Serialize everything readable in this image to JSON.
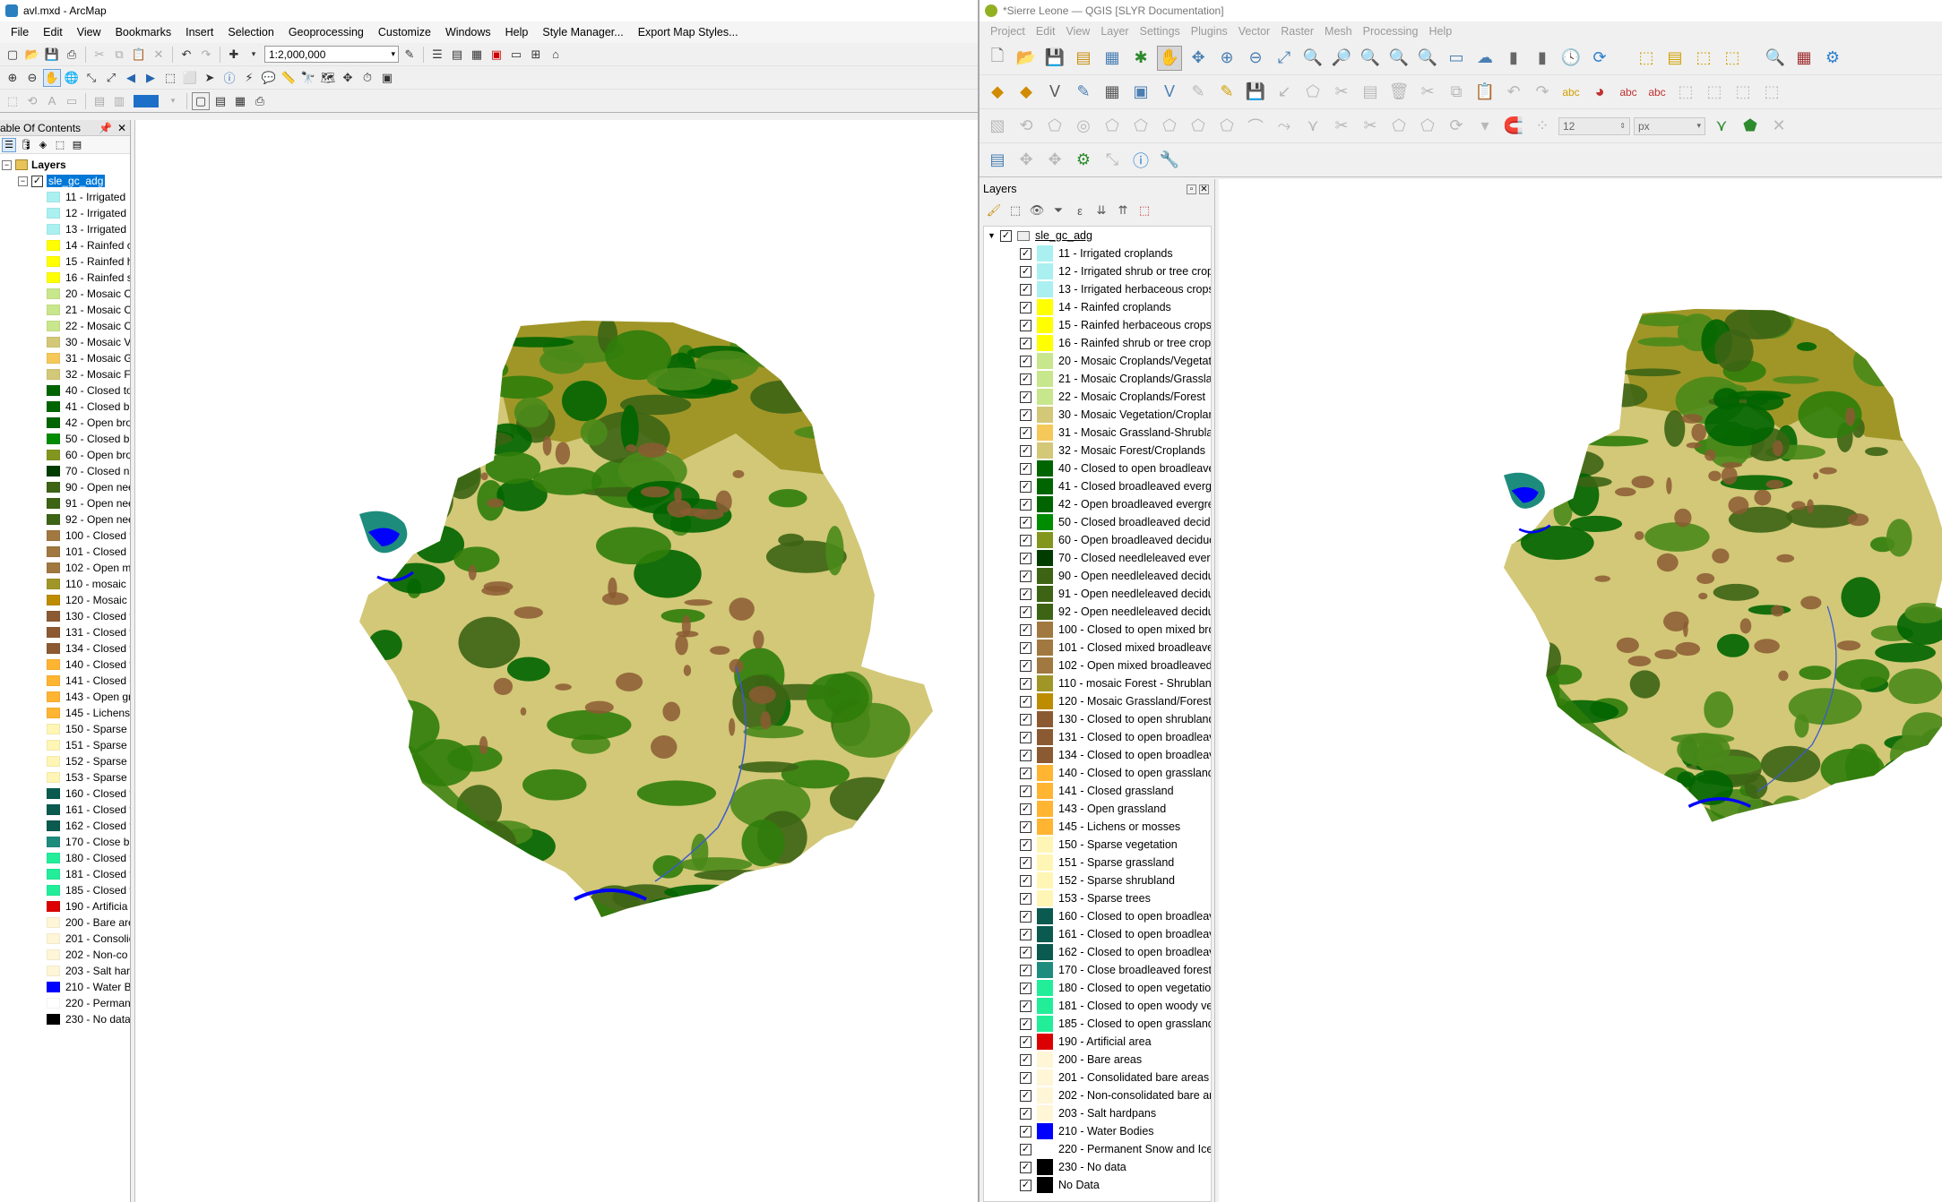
{
  "arcmap": {
    "title": "avl.mxd - ArcMap",
    "menus": [
      "File",
      "Edit",
      "View",
      "Bookmarks",
      "Insert",
      "Selection",
      "Geoprocessing",
      "Customize",
      "Windows",
      "Help",
      "Style Manager...",
      "Export Map Styles..."
    ],
    "scale": "1:2,000,000",
    "toc_title": "able Of Contents",
    "group_label": "Layers",
    "layer_name": "sle_gc_adg",
    "legend": [
      {
        "label": "11 - Irrigated",
        "color": "#aaf0f0"
      },
      {
        "label": "12 - Irrigated",
        "color": "#aaf0f0"
      },
      {
        "label": "13 - Irrigated",
        "color": "#aaf0f0"
      },
      {
        "label": "14 - Rainfed c",
        "color": "#ffff00"
      },
      {
        "label": "15 - Rainfed h",
        "color": "#ffff00"
      },
      {
        "label": "16 - Rainfed s",
        "color": "#ffff00"
      },
      {
        "label": "20 - Mosaic C",
        "color": "#c8e68c"
      },
      {
        "label": "21 - Mosaic C",
        "color": "#c8e68c"
      },
      {
        "label": "22 - Mosaic C",
        "color": "#c8e68c"
      },
      {
        "label": "30 - Mosaic V",
        "color": "#d2c878"
      },
      {
        "label": "31 - Mosaic G",
        "color": "#f5c85a"
      },
      {
        "label": "32 - Mosaic F",
        "color": "#d2c878"
      },
      {
        "label": "40 - Closed to",
        "color": "#006400"
      },
      {
        "label": "41 - Closed b",
        "color": "#006400"
      },
      {
        "label": "42 - Open bro",
        "color": "#006400"
      },
      {
        "label": "50 - Closed b",
        "color": "#008c00"
      },
      {
        "label": "60 - Open bro",
        "color": "#82961e"
      },
      {
        "label": "70 - Closed n",
        "color": "#003c00"
      },
      {
        "label": "90 - Open nee",
        "color": "#3c6414"
      },
      {
        "label": "91 - Open nee",
        "color": "#3c6414"
      },
      {
        "label": "92 - Open nee",
        "color": "#3c6414"
      },
      {
        "label": "100 - Closed t",
        "color": "#a07840"
      },
      {
        "label": "101 - Closed r",
        "color": "#a07840"
      },
      {
        "label": "102 - Open m",
        "color": "#a07840"
      },
      {
        "label": "110 - mosaic",
        "color": "#a09628"
      },
      {
        "label": "120 - Mosaic",
        "color": "#be8c00"
      },
      {
        "label": "130 - Closed t",
        "color": "#8c5a32"
      },
      {
        "label": "131 - Closed t",
        "color": "#8c5a32"
      },
      {
        "label": "134 - Closed t",
        "color": "#8c5a32"
      },
      {
        "label": "140 - Closed t",
        "color": "#ffb432"
      },
      {
        "label": "141 - Closed g",
        "color": "#ffb432"
      },
      {
        "label": "143 - Open gr",
        "color": "#ffb432"
      },
      {
        "label": "145 - Lichens",
        "color": "#ffb432"
      },
      {
        "label": "150 - Sparse v",
        "color": "#fff5b4"
      },
      {
        "label": "151 - Sparse g",
        "color": "#fff5b4"
      },
      {
        "label": "152 - Sparse s",
        "color": "#fff5b4"
      },
      {
        "label": "153 - Sparse t",
        "color": "#fff5b4"
      },
      {
        "label": "160 - Closed t",
        "color": "#0a5a50"
      },
      {
        "label": "161 - Closed t",
        "color": "#0a5a50"
      },
      {
        "label": "162 - Closed t",
        "color": "#0a5a50"
      },
      {
        "label": "170 - Close br",
        "color": "#1e8c7d"
      },
      {
        "label": "180 - Closed t",
        "color": "#22ee9a"
      },
      {
        "label": "181 - Closed t",
        "color": "#22ee9a"
      },
      {
        "label": "185 - Closed t",
        "color": "#22ee9a"
      },
      {
        "label": "190 - Artificia",
        "color": "#dc0000"
      },
      {
        "label": "200 - Bare are",
        "color": "#fff5d7"
      },
      {
        "label": "201 - Consolic",
        "color": "#fff5d7"
      },
      {
        "label": "202 - Non-co",
        "color": "#fff5d7"
      },
      {
        "label": "203 - Salt hard",
        "color": "#fff5d7"
      },
      {
        "label": "210 - Water B",
        "color": "#0000ff"
      },
      {
        "label": "220 - Perman",
        "color": "#ffffff"
      },
      {
        "label": "230 - No data",
        "color": "#000000"
      }
    ]
  },
  "qgis": {
    "title": "*Sierre Leone — QGIS [SLYR Documentation]",
    "menus": [
      "Project",
      "Edit",
      "View",
      "Layer",
      "Settings",
      "Plugins",
      "Vector",
      "Raster",
      "Mesh",
      "Processing",
      "Help"
    ],
    "font_size_value": "12",
    "font_unit": "px",
    "panel_title": "Layers",
    "layer_name": "sle_gc_adg",
    "legend": [
      {
        "label": "11 - Irrigated croplands",
        "color": "#aaf0f0"
      },
      {
        "label": "12 - Irrigated shrub or tree crops",
        "color": "#aaf0f0"
      },
      {
        "label": "13 - Irrigated herbaceous crops",
        "color": "#aaf0f0"
      },
      {
        "label": "14 - Rainfed croplands",
        "color": "#ffff00"
      },
      {
        "label": "15 - Rainfed herbaceous crops",
        "color": "#ffff00"
      },
      {
        "label": "16 - Rainfed shrub or tree crops",
        "color": "#ffff00"
      },
      {
        "label": "20 - Mosaic Croplands/Vegetatio",
        "color": "#c8e68c"
      },
      {
        "label": "21 - Mosaic Croplands/Grasslanc",
        "color": "#c8e68c"
      },
      {
        "label": "22 - Mosaic Croplands/Forest",
        "color": "#c8e68c"
      },
      {
        "label": "30 - Mosaic Vegetation/Croplanc",
        "color": "#d2c878"
      },
      {
        "label": "31 - Mosaic Grassland-Shrublanc",
        "color": "#f5c85a"
      },
      {
        "label": "32 - Mosaic Forest/Croplands",
        "color": "#d2c878"
      },
      {
        "label": "40 - Closed to open broadleaved",
        "color": "#006400"
      },
      {
        "label": "41 - Closed broadleaved evergre",
        "color": "#006400"
      },
      {
        "label": "42 - Open broadleaved evergreer",
        "color": "#006400"
      },
      {
        "label": "50 - Closed broadleaved deciduc",
        "color": "#008c00"
      },
      {
        "label": "60 - Open broadleaved deciduou",
        "color": "#82961e"
      },
      {
        "label": "70 - Closed needleleaved evergre",
        "color": "#003c00"
      },
      {
        "label": "90 - Open needleleaved deciduo",
        "color": "#3c6414"
      },
      {
        "label": "91 - Open needleleaved deciduo",
        "color": "#3c6414"
      },
      {
        "label": "92 - Open needleleaved deciduo",
        "color": "#3c6414"
      },
      {
        "label": "100 - Closed to open mixed broa",
        "color": "#a07840"
      },
      {
        "label": "101 - Closed mixed broadleaved",
        "color": "#a07840"
      },
      {
        "label": "102 - Open mixed broadleaved a",
        "color": "#a07840"
      },
      {
        "label": "110 - mosaic Forest - Shrubland/",
        "color": "#a09628"
      },
      {
        "label": "120 - Mosaic Grassland/Forest - S",
        "color": "#be8c00"
      },
      {
        "label": "130 - Closed to open shrubland",
        "color": "#8c5a32"
      },
      {
        "label": "131 - Closed to open broadleavel",
        "color": "#8c5a32"
      },
      {
        "label": "134 - Closed to open broadleavel",
        "color": "#8c5a32"
      },
      {
        "label": "140 - Closed to open grassland",
        "color": "#ffb432"
      },
      {
        "label": "141 - Closed grassland",
        "color": "#ffb432"
      },
      {
        "label": "143 - Open grassland",
        "color": "#ffb432"
      },
      {
        "label": "145 - Lichens or mosses",
        "color": "#ffb432"
      },
      {
        "label": "150 - Sparse vegetation",
        "color": "#fff5b4"
      },
      {
        "label": "151 - Sparse grassland",
        "color": "#fff5b4"
      },
      {
        "label": "152 - Sparse shrubland",
        "color": "#fff5b4"
      },
      {
        "label": "153 - Sparse trees",
        "color": "#fff5b4"
      },
      {
        "label": "160 - Closed to open broadleave",
        "color": "#0a5a50"
      },
      {
        "label": "161 - Closed to open broadleave",
        "color": "#0a5a50"
      },
      {
        "label": "162 - Closed to open broadleave",
        "color": "#0a5a50"
      },
      {
        "label": "170 - Close broadleaved forest pe",
        "color": "#1e8c7d"
      },
      {
        "label": "180 - Closed to open vegetation",
        "color": "#22ee9a"
      },
      {
        "label": "181 - Closed to open woody vege",
        "color": "#22ee9a"
      },
      {
        "label": "185 - Closed to open grassland re",
        "color": "#22ee9a"
      },
      {
        "label": "190 - Artificial area",
        "color": "#dc0000"
      },
      {
        "label": "200 - Bare areas",
        "color": "#fff5d7"
      },
      {
        "label": "201 - Consolidated bare areas",
        "color": "#fff5d7"
      },
      {
        "label": "202 - Non-consolidated bare area",
        "color": "#fff5d7"
      },
      {
        "label": "203 - Salt hardpans",
        "color": "#fff5d7"
      },
      {
        "label": "210 - Water Bodies",
        "color": "#0000ff"
      },
      {
        "label": "220 -  Permanent Snow and Ice",
        "color": "#ffffff"
      },
      {
        "label": "230 - No data",
        "color": "#000000"
      },
      {
        "label": "No Data",
        "color": "#000000"
      }
    ]
  }
}
